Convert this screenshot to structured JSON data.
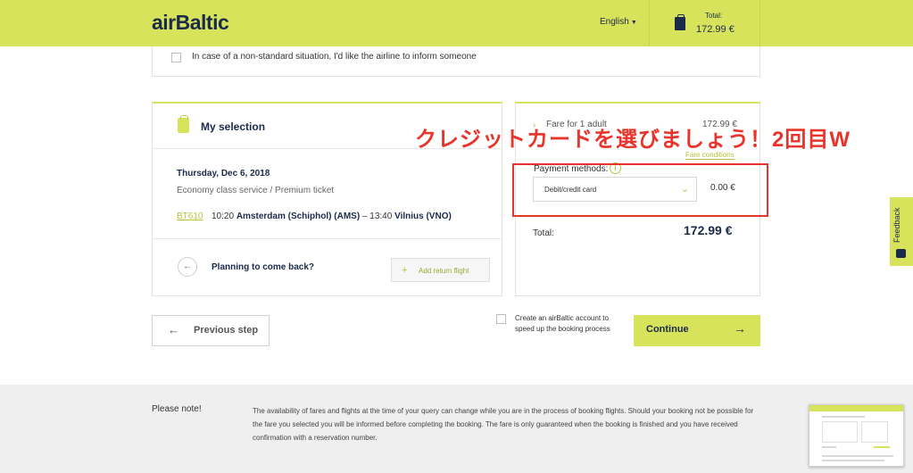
{
  "header": {
    "logo": "airBaltic",
    "language": "English",
    "cart_label": "Total:",
    "cart_total": "172.99 €"
  },
  "notice": {
    "text": "In case of a non-standard situation, I'd like the airline to inform someone"
  },
  "selection": {
    "title": "My selection",
    "date": "Thursday, Dec 6, 2018",
    "class": "Economy class service / Premium ticket",
    "flight_no": "BT610",
    "dep_time": "10:20",
    "dep_airport": "Amsterdam (Schiphol) (AMS)",
    "sep": "–",
    "arr_time": "13:40",
    "arr_airport": "Vilnius (VNO)",
    "return_question": "Planning to come back?",
    "add_return": "Add return flight"
  },
  "fare": {
    "label": "Fare for 1 adult",
    "value": "172.99 €",
    "conditions": "Fare conditions",
    "payment_label": "Payment methods:",
    "payment_selected": "Debit/credit card",
    "payment_fee": "0.00 €",
    "total_label": "Total:",
    "total_value": "172.99 €"
  },
  "annotation": {
    "text": "クレジットカードを選びましょう！2回目W",
    "color": "#e8342b"
  },
  "actions": {
    "previous": "Previous step",
    "account_text": "Create an airBaltic account to speed up the booking process",
    "continue": "Continue"
  },
  "footer": {
    "title": "Please note!",
    "text": "The availability of fares and flights at the time of your query can change while you are in the process of booking flights. Should your booking not be possible for the fare you selected you will be informed before completing the booking. The fare is only guaranteed when the booking is finished and you have received confirmation with a reservation number."
  },
  "feedback": {
    "label": "Feedback"
  },
  "colors": {
    "brand": "#d7e35a",
    "navy": "#1a2a4a",
    "link": "#b6c43a"
  }
}
